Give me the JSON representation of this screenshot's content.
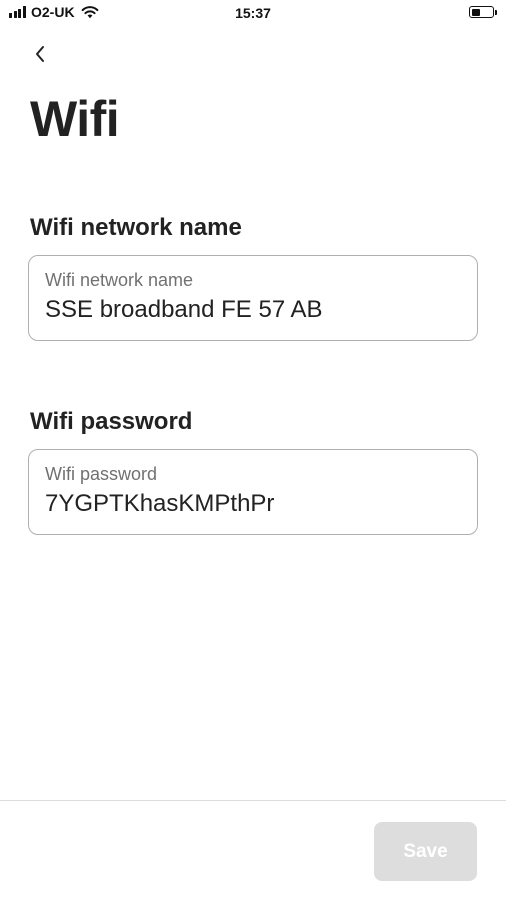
{
  "status_bar": {
    "carrier": "O2-UK",
    "time": "15:37",
    "signal_icon": "signal-bars-icon",
    "wifi_icon": "wifi-icon",
    "battery_icon": "battery-icon",
    "battery_level": 0.4
  },
  "header": {
    "back_icon": "chevron-left-icon",
    "title": "Wifi"
  },
  "network_section": {
    "heading": "Wifi network name",
    "field_label": "Wifi network name",
    "value": "SSE broadband FE 57 AB"
  },
  "password_section": {
    "heading": "Wifi password",
    "field_label": "Wifi password",
    "value": "7YGPTKhasKMPthPr"
  },
  "footer": {
    "save_label": "Save",
    "save_enabled": false
  },
  "colors": {
    "text_primary": "#222222",
    "text_secondary": "#717171",
    "field_border": "#b0b0b0",
    "divider": "#dddddd",
    "button_disabled_bg": "#dddddd",
    "button_disabled_text": "#ffffff"
  }
}
